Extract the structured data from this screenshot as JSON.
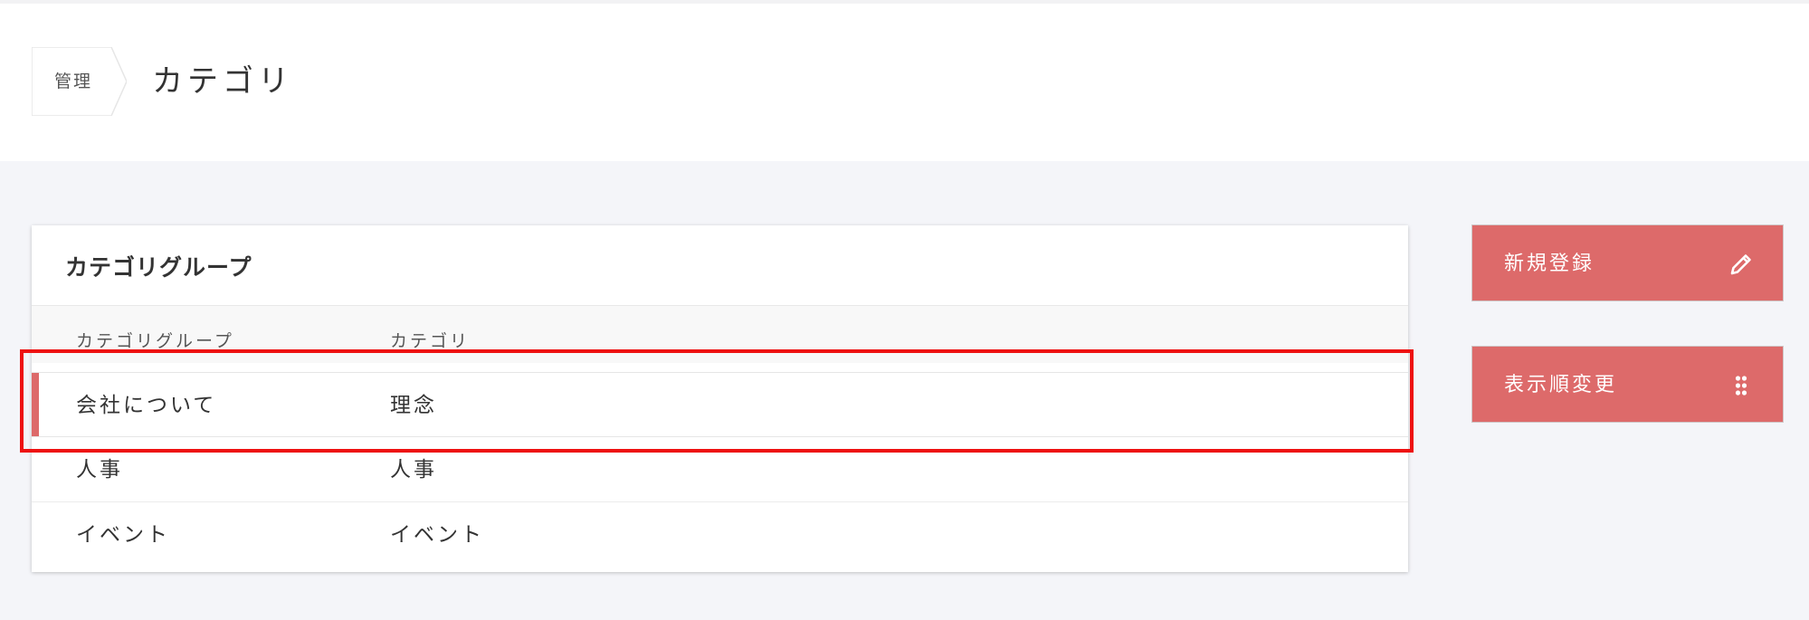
{
  "header": {
    "breadcrumb": "管理",
    "title": "カテゴリ"
  },
  "card": {
    "title": "カテゴリグループ",
    "columns": [
      "カテゴリグループ",
      "カテゴリ"
    ],
    "rows": [
      {
        "group": "会社について",
        "category": "理念",
        "selected": true
      },
      {
        "group": "人事",
        "category": "人事",
        "selected": false
      },
      {
        "group": "イベント",
        "category": "イベント",
        "selected": false
      }
    ]
  },
  "actions": {
    "new_label": "新規登録",
    "new_icon": "pencil-icon",
    "reorder_label": "表示順変更",
    "reorder_icon": "drag-handle-icon"
  },
  "colors": {
    "accent": "#dd6a6a",
    "highlight": "#ee1111"
  }
}
